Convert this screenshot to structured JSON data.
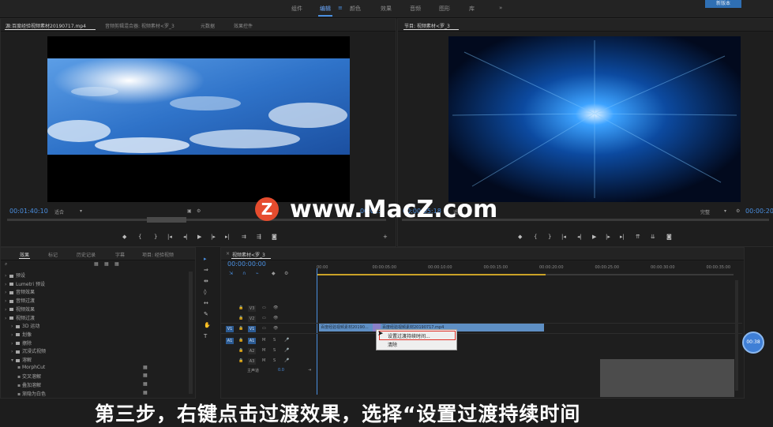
{
  "workspace": {
    "items": [
      "组件",
      "编辑",
      "颜色",
      "效果",
      "音频",
      "图形",
      "库",
      "»"
    ],
    "active": "编辑",
    "corner": "新版本"
  },
  "source_monitor": {
    "tabs": [
      "源:百度经验视频素材20190717.mp4",
      "音频剪辑混合器: 视频素材<罗_3",
      "元数据",
      "效果控件"
    ],
    "timecode": "00:01:40:10",
    "fit": "适合",
    "timecode_right": "00:01:"
  },
  "program_monitor": {
    "tab": "节目: 视频素材<罗_3",
    "timecode_left": "00:00:05:18",
    "fit": "适合",
    "quality": "完整",
    "timecode_right": "00:00:20:"
  },
  "effects_panel": {
    "tabs": [
      "效果",
      "标记",
      "历史记录",
      "字幕",
      "项目: 经验视频"
    ],
    "search_placeholder": "",
    "tree": [
      {
        "label": "预设",
        "level": 0
      },
      {
        "label": "Lumetri 预设",
        "level": 0
      },
      {
        "label": "音频效果",
        "level": 0
      },
      {
        "label": "音频过渡",
        "level": 0
      },
      {
        "label": "视频效果",
        "level": 0
      },
      {
        "label": "视频过渡",
        "level": 0
      },
      {
        "label": "3D 运动",
        "level": 1
      },
      {
        "label": "划像",
        "level": 1
      },
      {
        "label": "擦除",
        "level": 1
      },
      {
        "label": "沉浸式视频",
        "level": 1
      },
      {
        "label": "溶解",
        "level": 1
      },
      {
        "label": "MorphCut",
        "level": 2
      },
      {
        "label": "交叉溶解",
        "level": 2
      },
      {
        "label": "叠加溶解",
        "level": 2
      },
      {
        "label": "渐隐为白色",
        "level": 2
      }
    ]
  },
  "timeline": {
    "tab": "视频素材<罗_3",
    "timecode": "00:00:00:00",
    "ruler": [
      "00:00",
      "00:00:05:00",
      "00:00:10:00",
      "00:00:15:00",
      "00:00:20:00",
      "00:00:25:00",
      "00:00:30:00",
      "00:00:35:00"
    ],
    "tracks": [
      {
        "target": "",
        "name": "V3"
      },
      {
        "target": "",
        "name": "V2"
      },
      {
        "target": "V1",
        "name": "V1"
      },
      {
        "target": "A1",
        "name": "A1"
      },
      {
        "target": "",
        "name": "A2"
      },
      {
        "target": "",
        "name": "A3"
      }
    ],
    "master": "主声道",
    "master_value": "0.0",
    "clip1": "百度经验视频素材20190...",
    "clip2": "百度经验视频素材20190717.mp4",
    "time_bubble": "00:38"
  },
  "context_menu": {
    "items": [
      "设置过渡持续时间...",
      "清除"
    ]
  },
  "watermark": {
    "icon": "Z",
    "text": "www.MacZ.com"
  },
  "subtitle": "第三步，右键点击过渡效果，选择“设置过渡持续时间"
}
